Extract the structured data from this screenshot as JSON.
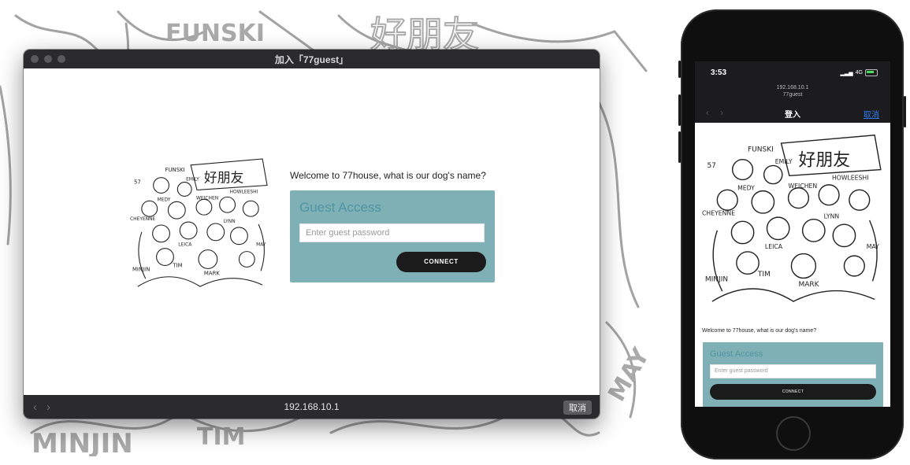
{
  "colors": {
    "card_bg": "#7fb0b6",
    "card_title": "#4e96a4",
    "button_bg": "#1b1b1b",
    "titlebar": "#2b2b2d",
    "link_blue": "#2f7df6"
  },
  "desktop": {
    "window_title": "加入「77guest」",
    "url": "192.168.10.1",
    "cancel_label": "取消",
    "back_icon": "chevron-left-icon",
    "forward_icon": "chevron-right-icon",
    "question": "Welcome to 77house, what is our dog's name?",
    "card_title": "Guest Access",
    "password_placeholder": "Enter guest password",
    "connect_label": "CONNECT"
  },
  "phone": {
    "time": "3:53",
    "network": "4G",
    "url": "192.168.10.1",
    "ssid": "77guest",
    "page_title": "登入",
    "cancel_label": "取消",
    "question": "Welcome to 77house, what is our dog's name?",
    "card_title": "Guest Access",
    "password_placeholder": "Enter guest password",
    "connect_label": "CONNECT"
  },
  "illustration": {
    "banner_text": "好朋友",
    "names": [
      "57",
      "FUNSKI",
      "EMILY",
      "MEDY",
      "CHEYENNE",
      "WEICHEN",
      "HOWLEESHI",
      "LEICA",
      "LYNN",
      "MAY",
      "MINJIN",
      "TIM",
      "MARK"
    ]
  }
}
